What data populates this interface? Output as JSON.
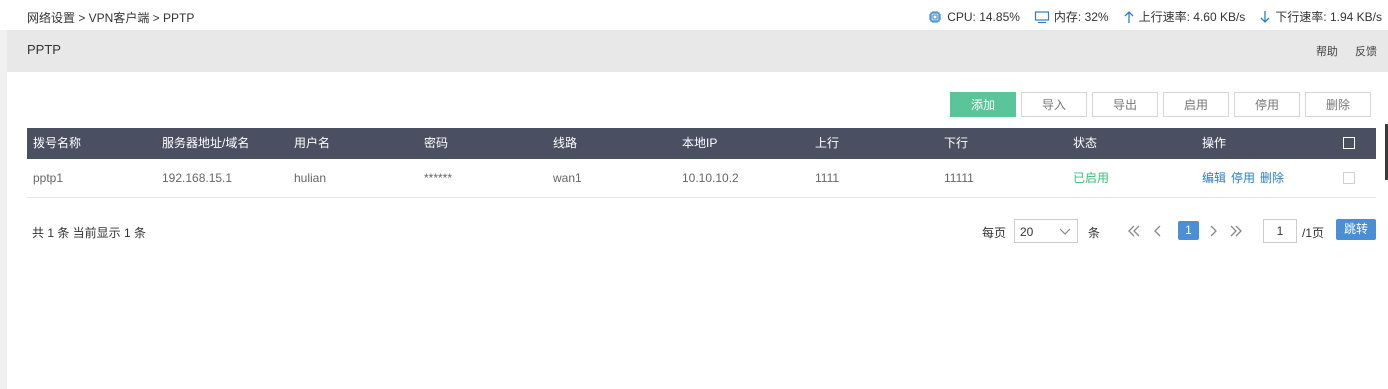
{
  "breadcrumb": "网络设置 > VPN客户端 > PPTP",
  "stats": {
    "cpu": "CPU: 14.85%",
    "memory": "内存: 32%",
    "upload": "上行速率: 4.60 KB/s",
    "download": "下行速率: 1.94 KB/s"
  },
  "header": {
    "title": "PPTP",
    "help": "帮助",
    "feedback": "反馈"
  },
  "toolbar": {
    "add": "添加",
    "import": "导入",
    "export": "导出",
    "enable": "启用",
    "disable": "停用",
    "delete": "删除"
  },
  "table": {
    "columns": [
      "拨号名称",
      "服务器地址/域名",
      "用户名",
      "密码",
      "线路",
      "本地IP",
      "上行",
      "下行",
      "状态",
      "操作"
    ],
    "rows": [
      {
        "name": "pptp1",
        "server": "192.168.15.1",
        "user": "hulian",
        "password": "******",
        "line": "wan1",
        "local_ip": "10.10.10.2",
        "up": "1111",
        "down": "11111",
        "status": "已启用",
        "ops": {
          "edit": "编辑",
          "disable": "停用",
          "delete": "删除"
        }
      }
    ]
  },
  "footer": {
    "summary": "共 1 条 当前显示 1 条",
    "per_page_label": "每页",
    "per_page_value": "20",
    "per_page_unit": "条",
    "current_page": "1",
    "page_input": "1",
    "page_total": "/1页",
    "jump": "跳转"
  },
  "colors": {
    "accent_green": "#5ac598",
    "header_dark": "#4b4f62",
    "link_blue": "#2a7fc8",
    "pager_blue": "#4a8fd6"
  },
  "icons": {
    "cpu": "chip-icon",
    "memory": "monitor-icon",
    "upload": "arrow-up-icon",
    "download": "arrow-down-icon"
  }
}
